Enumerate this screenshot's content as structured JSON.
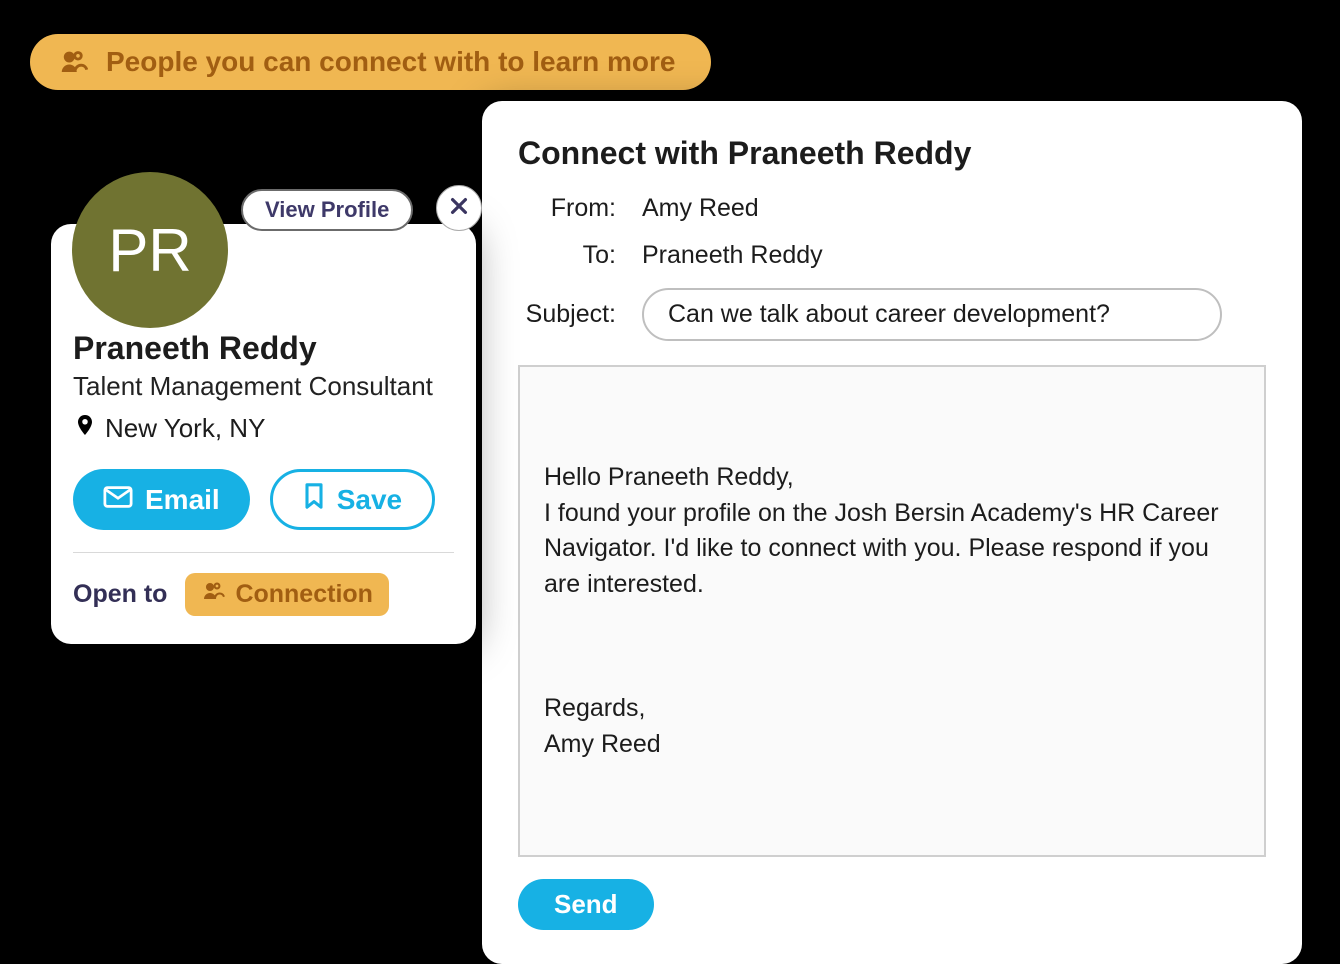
{
  "header": {
    "label": "People you can connect with to learn more"
  },
  "profile": {
    "initials": "PR",
    "view_profile_label": "View Profile",
    "name": "Praneeth Reddy",
    "title": "Talent Management Consultant",
    "location": "New York, NY",
    "email_label": "Email",
    "save_label": "Save",
    "open_to_label": "Open to",
    "open_to_chip": "Connection"
  },
  "compose": {
    "title": "Connect with Praneeth Reddy",
    "from_label": "From:",
    "from_value": "Amy Reed",
    "to_label": "To:",
    "to_value": "Praneeth Reddy",
    "subject_label": "Subject:",
    "subject_value": "Can we talk about career development?",
    "body_p1": "Hello Praneeth Reddy,\nI found your profile on the Josh Bersin Academy's HR Career Navigator. I'd like to connect with you. Please respond if you are interested.",
    "body_p2": "Regards,\nAmy Reed",
    "send_label": "Send"
  }
}
